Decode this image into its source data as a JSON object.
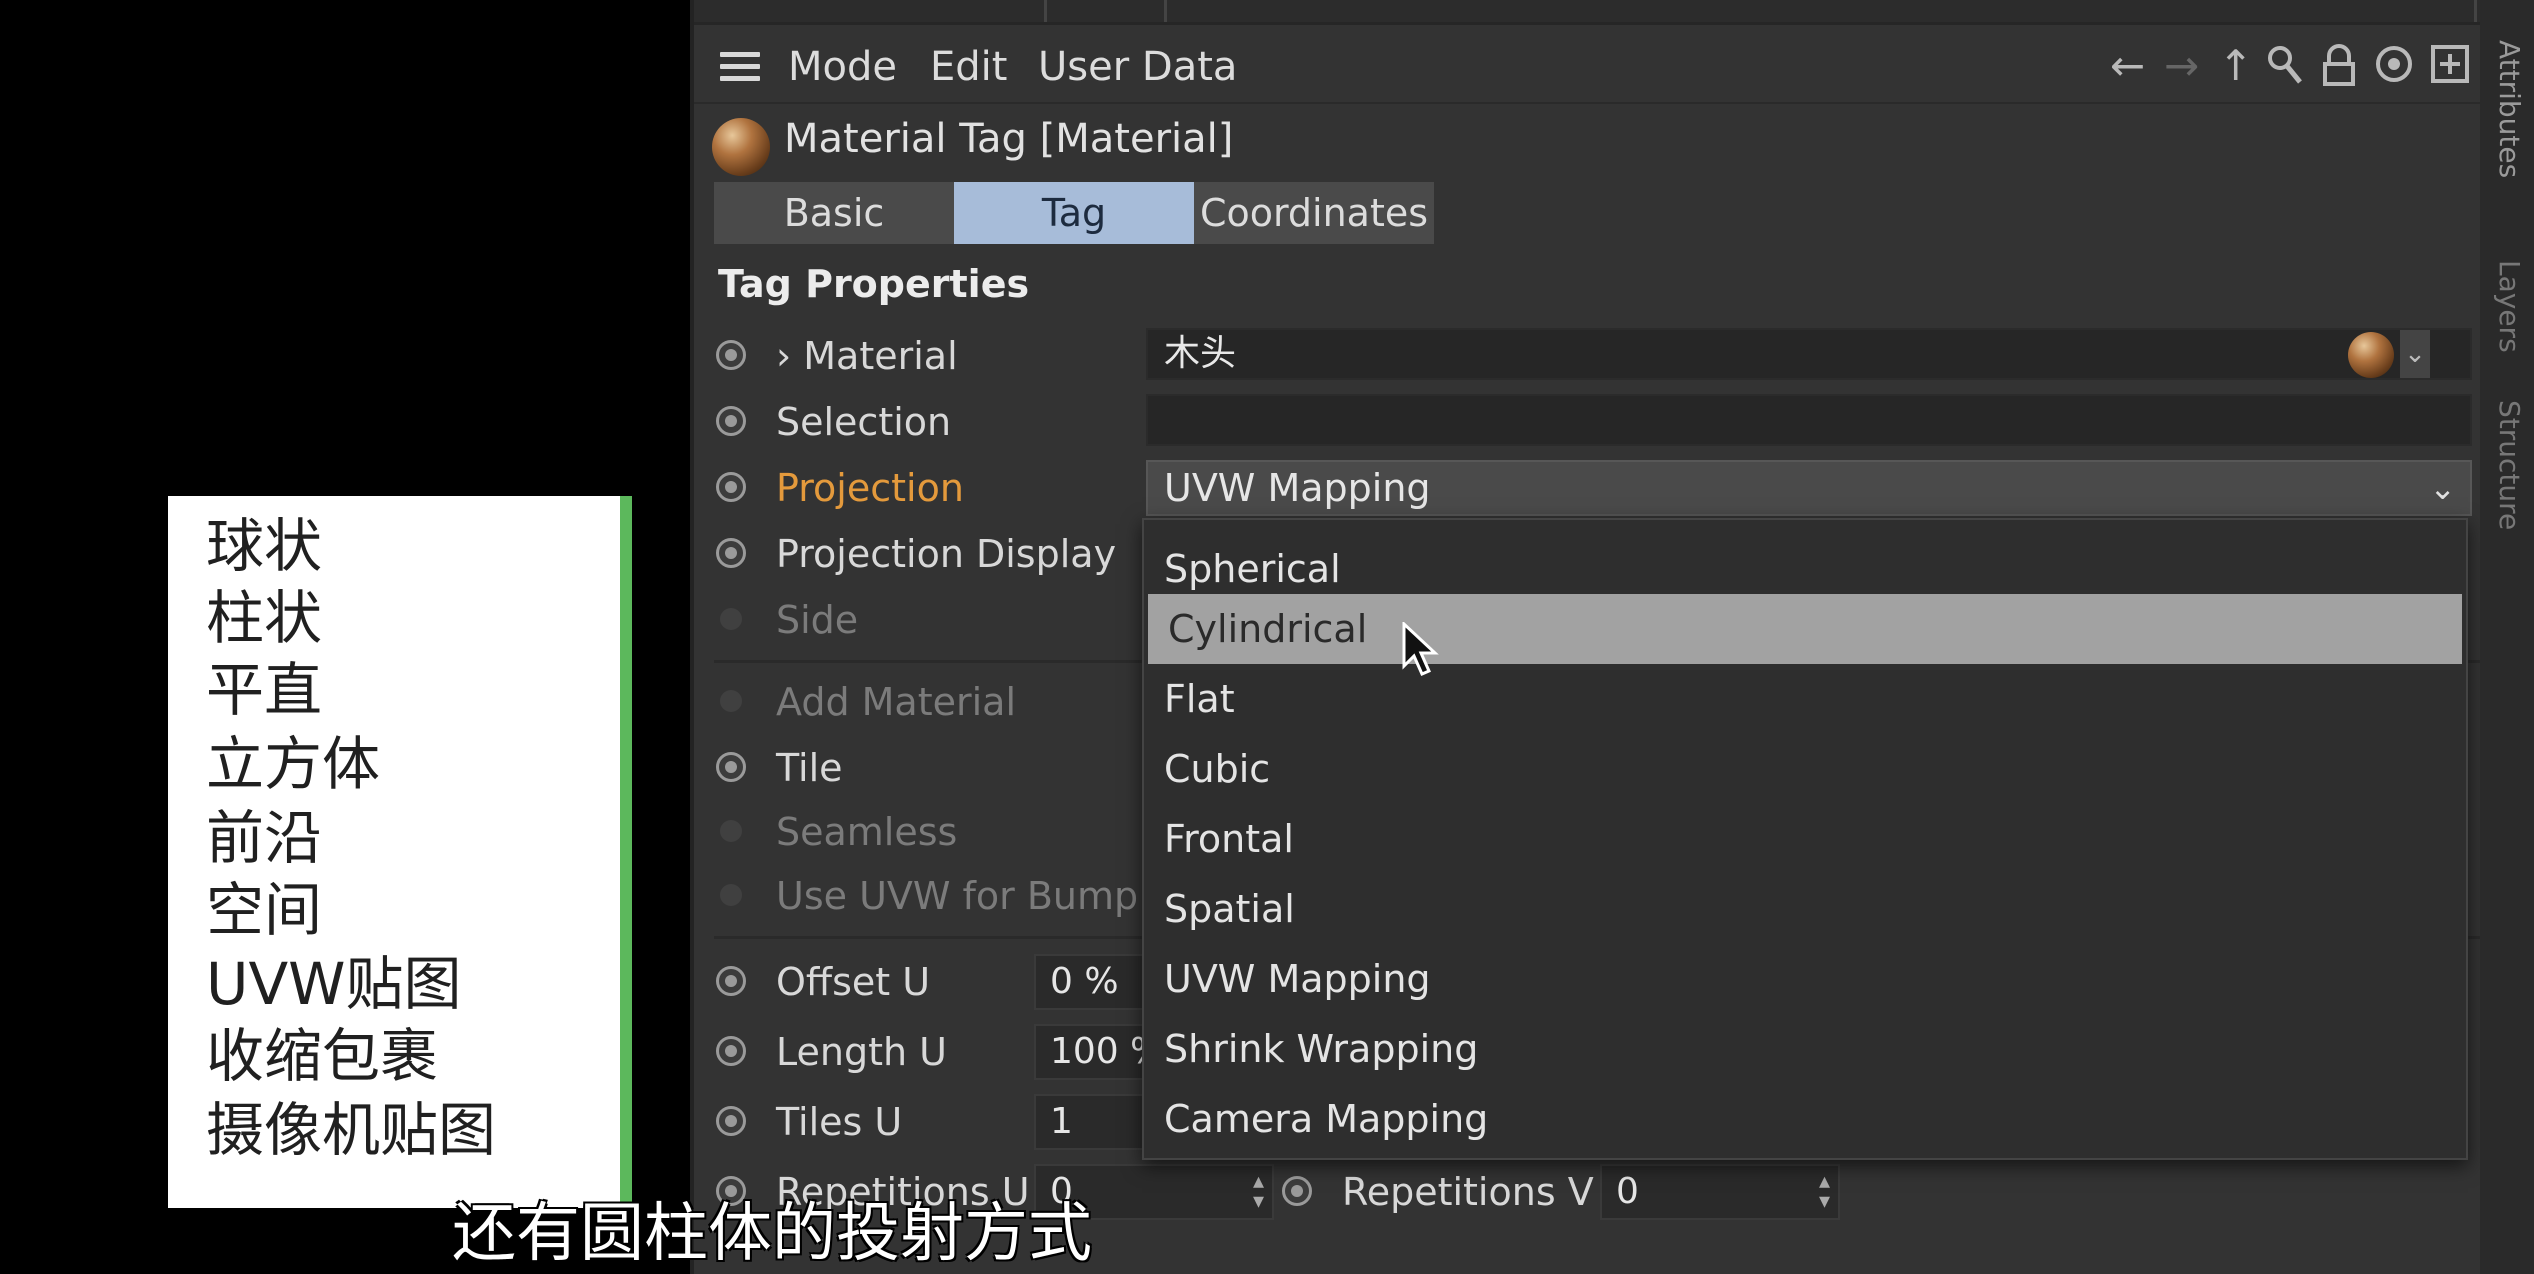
{
  "menubar": {
    "items": [
      "Mode",
      "Edit",
      "User Data"
    ],
    "icons": [
      "arrow-left-icon",
      "arrow-right-icon",
      "arrow-up-icon",
      "search-icon",
      "lock-icon",
      "target-icon",
      "add-icon"
    ]
  },
  "header": {
    "title": "Material Tag [Material]"
  },
  "tabs": [
    {
      "label": "Basic",
      "active": false
    },
    {
      "label": "Tag",
      "active": true
    },
    {
      "label": "Coordinates",
      "active": false
    }
  ],
  "section": {
    "title": "Tag Properties"
  },
  "properties": {
    "material": {
      "label": "› Material",
      "value": "木头"
    },
    "selection": {
      "label": "Selection",
      "value": ""
    },
    "projection": {
      "label": "Projection",
      "value": "UVW Mapping"
    },
    "projection_display": {
      "label": "Projection Display"
    },
    "side": {
      "label": "Side"
    },
    "add_material": {
      "label": "Add Material"
    },
    "tile": {
      "label": "Tile"
    },
    "seamless": {
      "label": "Seamless"
    },
    "use_uvw_bump": {
      "label": "Use UVW for Bump"
    },
    "offset_u": {
      "label": "Offset U",
      "value": "0 %"
    },
    "length_u": {
      "label": "Length U",
      "value": "100 %"
    },
    "tiles_u": {
      "label": "Tiles U",
      "value": "1"
    },
    "repetitions_u": {
      "label": "Repetitions U",
      "value": "0"
    },
    "repetitions_v": {
      "label": "Repetitions V",
      "value": "0"
    }
  },
  "dropdown": {
    "options": [
      "Spherical",
      "Cylindrical",
      "Flat",
      "Cubic",
      "Frontal",
      "Spatial",
      "UVW Mapping",
      "Shrink Wrapping",
      "Camera Mapping"
    ],
    "highlighted": "Cylindrical"
  },
  "side_tabs": [
    "Attributes",
    "Layers",
    "Structure"
  ],
  "legend": {
    "items": [
      "球状",
      "柱状",
      "平直",
      "立方体",
      "前沿",
      "空间",
      "UVW贴图",
      "收缩包裹",
      "摄像机贴图"
    ]
  },
  "subtitle": "还有圆柱体的投射方式",
  "colors": {
    "panel_bg": "#333333",
    "active_tab": "#a7bcd9",
    "projection_label": "#e49a3c",
    "highlight": "#a2a2a2",
    "legend_border": "#5cb85c"
  }
}
